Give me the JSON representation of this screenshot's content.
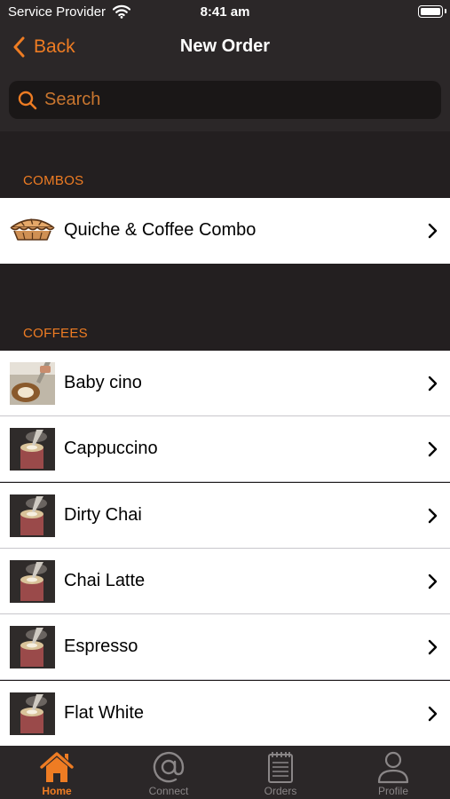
{
  "status_bar": {
    "carrier": "Service Provider",
    "time": "8:41 am"
  },
  "nav": {
    "back_label": "Back",
    "title": "New Order"
  },
  "search": {
    "placeholder": "Search"
  },
  "sections": {
    "combos": {
      "title": "COMBOS",
      "items": [
        {
          "label": "Quiche & Coffee Combo",
          "icon": "pie-icon"
        }
      ]
    },
    "coffees": {
      "title": "COFFEES",
      "items": [
        {
          "label": "Baby cino"
        },
        {
          "label": "Cappuccino"
        },
        {
          "label": "Dirty Chai"
        },
        {
          "label": "Chai Latte"
        },
        {
          "label": "Espresso"
        },
        {
          "label": "Flat White"
        }
      ]
    }
  },
  "tabs": [
    {
      "label": "Home",
      "icon": "home-icon",
      "active": true
    },
    {
      "label": "Connect",
      "icon": "at-sign-icon",
      "active": false
    },
    {
      "label": "Orders",
      "icon": "notepad-icon",
      "active": false
    },
    {
      "label": "Profile",
      "icon": "person-icon",
      "active": false
    }
  ],
  "colors": {
    "accent": "#ee7c23",
    "bar_background": "#2b2728",
    "section_background": "#231f20",
    "row_background": "#ffffff"
  }
}
